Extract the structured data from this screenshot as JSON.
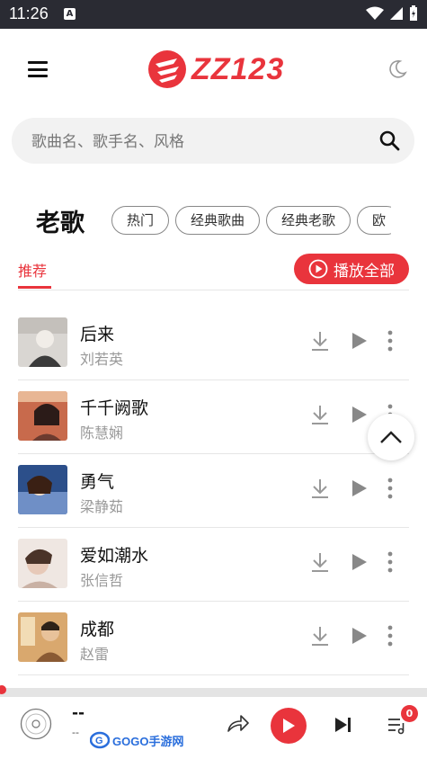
{
  "status_bar": {
    "time": "11:26",
    "notification_letter": "A"
  },
  "header": {
    "logo_text": "ZZ123"
  },
  "search": {
    "placeholder": "歌曲名、歌手名、风格"
  },
  "category": {
    "title": "老歌",
    "chips": [
      "热门",
      "经典歌曲",
      "经典老歌",
      "欧"
    ]
  },
  "tabs": {
    "recommend_label": "推荐"
  },
  "play_all_label": "播放全部",
  "songs": [
    {
      "title": "后来",
      "artist": "刘若英"
    },
    {
      "title": "千千阙歌",
      "artist": "陈慧娴"
    },
    {
      "title": "勇气",
      "artist": "梁静茹"
    },
    {
      "title": "爱如潮水",
      "artist": "张信哲"
    },
    {
      "title": "成都",
      "artist": "赵雷"
    }
  ],
  "player": {
    "title": "--",
    "artist": "--",
    "queue_count": "0",
    "watermark_text": "GOGO手游网"
  },
  "colors": {
    "accent": "#e9343c",
    "status_bar": "#2a2b33"
  }
}
